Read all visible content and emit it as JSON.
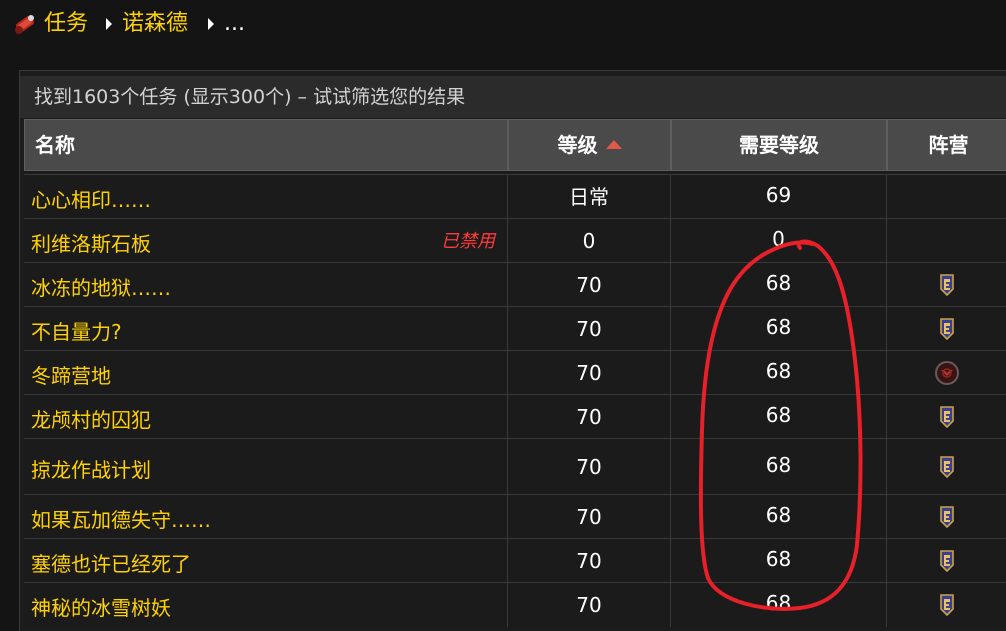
{
  "breadcrumb": {
    "logo_icon": "quest-scroll-icon",
    "items": [
      "任务",
      "诺森德"
    ],
    "more": "..."
  },
  "panel": {
    "summary": "找到1603个任务 (显示300个) – 试试筛选您的结果"
  },
  "table": {
    "columns": {
      "name": "名称",
      "level": "等级",
      "required_level": "需要等级",
      "faction": "阵营"
    },
    "sort": {
      "column": "level",
      "direction": "ascending",
      "color": "#e05a4a"
    },
    "rows": [
      {
        "name": "心心相印……",
        "level": "日常",
        "required_level": "69",
        "faction": "",
        "tag": ""
      },
      {
        "name": "利维洛斯石板",
        "level": "0",
        "required_level": "0",
        "faction": "",
        "tag": "已禁用"
      },
      {
        "name": "冰冻的地狱……",
        "level": "70",
        "required_level": "68",
        "faction": "alliance",
        "tag": ""
      },
      {
        "name": "不自量力?",
        "level": "70",
        "required_level": "68",
        "faction": "alliance",
        "tag": ""
      },
      {
        "name": "冬蹄营地",
        "level": "70",
        "required_level": "68",
        "faction": "horde",
        "tag": ""
      },
      {
        "name": "龙颅村的囚犯",
        "level": "70",
        "required_level": "68",
        "faction": "alliance",
        "tag": ""
      },
      {
        "name": "掠龙作战计划",
        "level": "70",
        "required_level": "68",
        "faction": "alliance",
        "tag": ""
      },
      {
        "name": "如果瓦加德失守……",
        "level": "70",
        "required_level": "68",
        "faction": "alliance",
        "tag": ""
      },
      {
        "name": "塞德也许已经死了",
        "level": "70",
        "required_level": "68",
        "faction": "alliance",
        "tag": ""
      },
      {
        "name": "神秘的冰雪树妖",
        "level": "70",
        "required_level": "68",
        "faction": "alliance",
        "tag": ""
      }
    ]
  },
  "icons": {
    "alliance": "alliance-shield-icon",
    "horde": "horde-emblem-icon"
  },
  "colors": {
    "quest_link": "#ffd100",
    "disabled": "#ff3a3a",
    "annotation": "#e8202a"
  }
}
